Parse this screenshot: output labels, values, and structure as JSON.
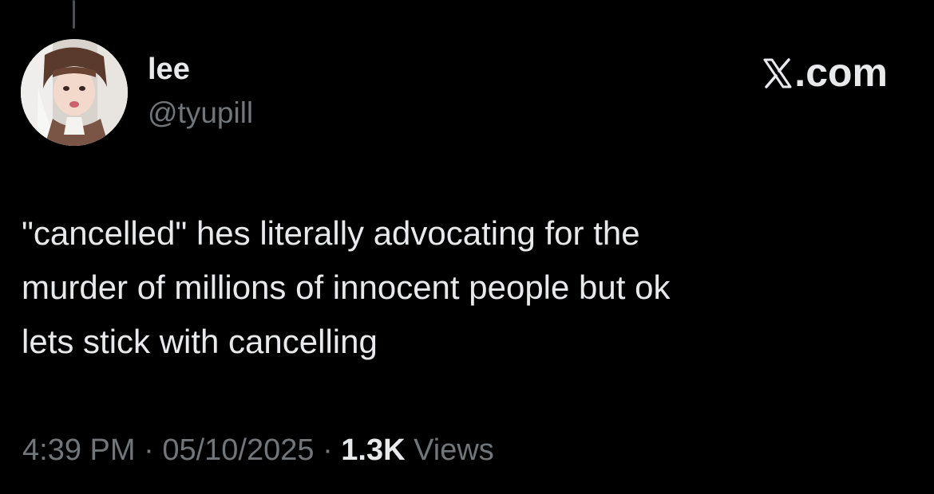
{
  "author": {
    "display_name": "lee",
    "handle": "@tyupill",
    "avatar": "profile-photo"
  },
  "source_label": ".com",
  "source_logo": "x-logo",
  "tweet": {
    "lines": [
      "\"cancelled\" hes literally advocating for the",
      "murder of millions of innocent people but ok",
      "lets stick with cancelling"
    ]
  },
  "meta": {
    "time": "4:39 PM",
    "separator": "·",
    "date": "05/10/2025",
    "views_count": "1.3K",
    "views_label": "Views"
  },
  "colors": {
    "background": "#000000",
    "primary_text": "#e7e9ea",
    "secondary_text": "#71767b"
  }
}
